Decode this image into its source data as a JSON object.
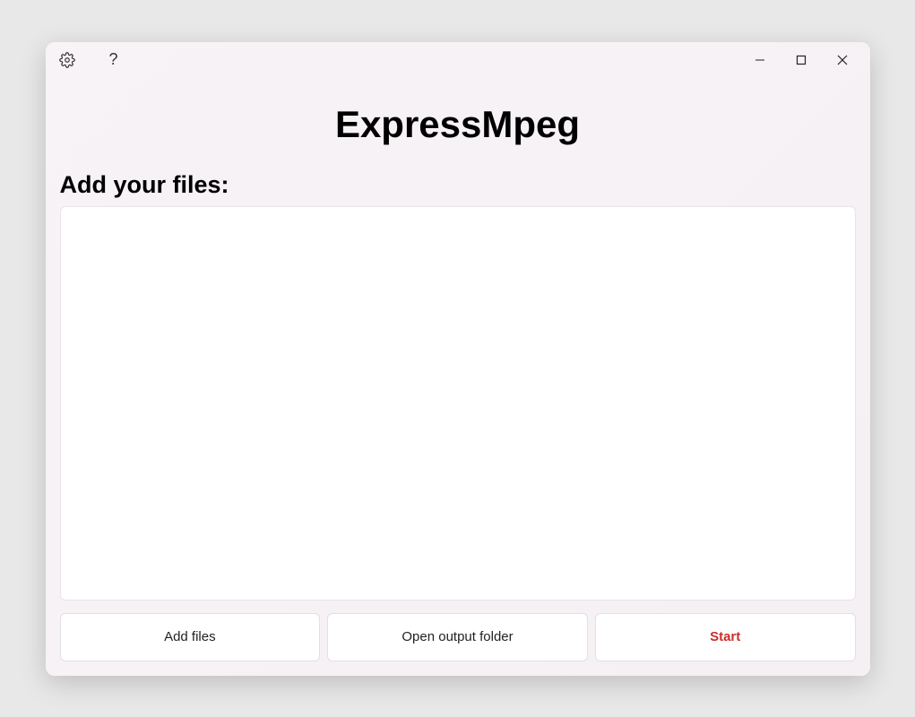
{
  "app": {
    "title": "ExpressMpeg"
  },
  "main": {
    "section_label": "Add your files:"
  },
  "buttons": {
    "add_files": "Add files",
    "open_output_folder": "Open output folder",
    "start": "Start"
  }
}
